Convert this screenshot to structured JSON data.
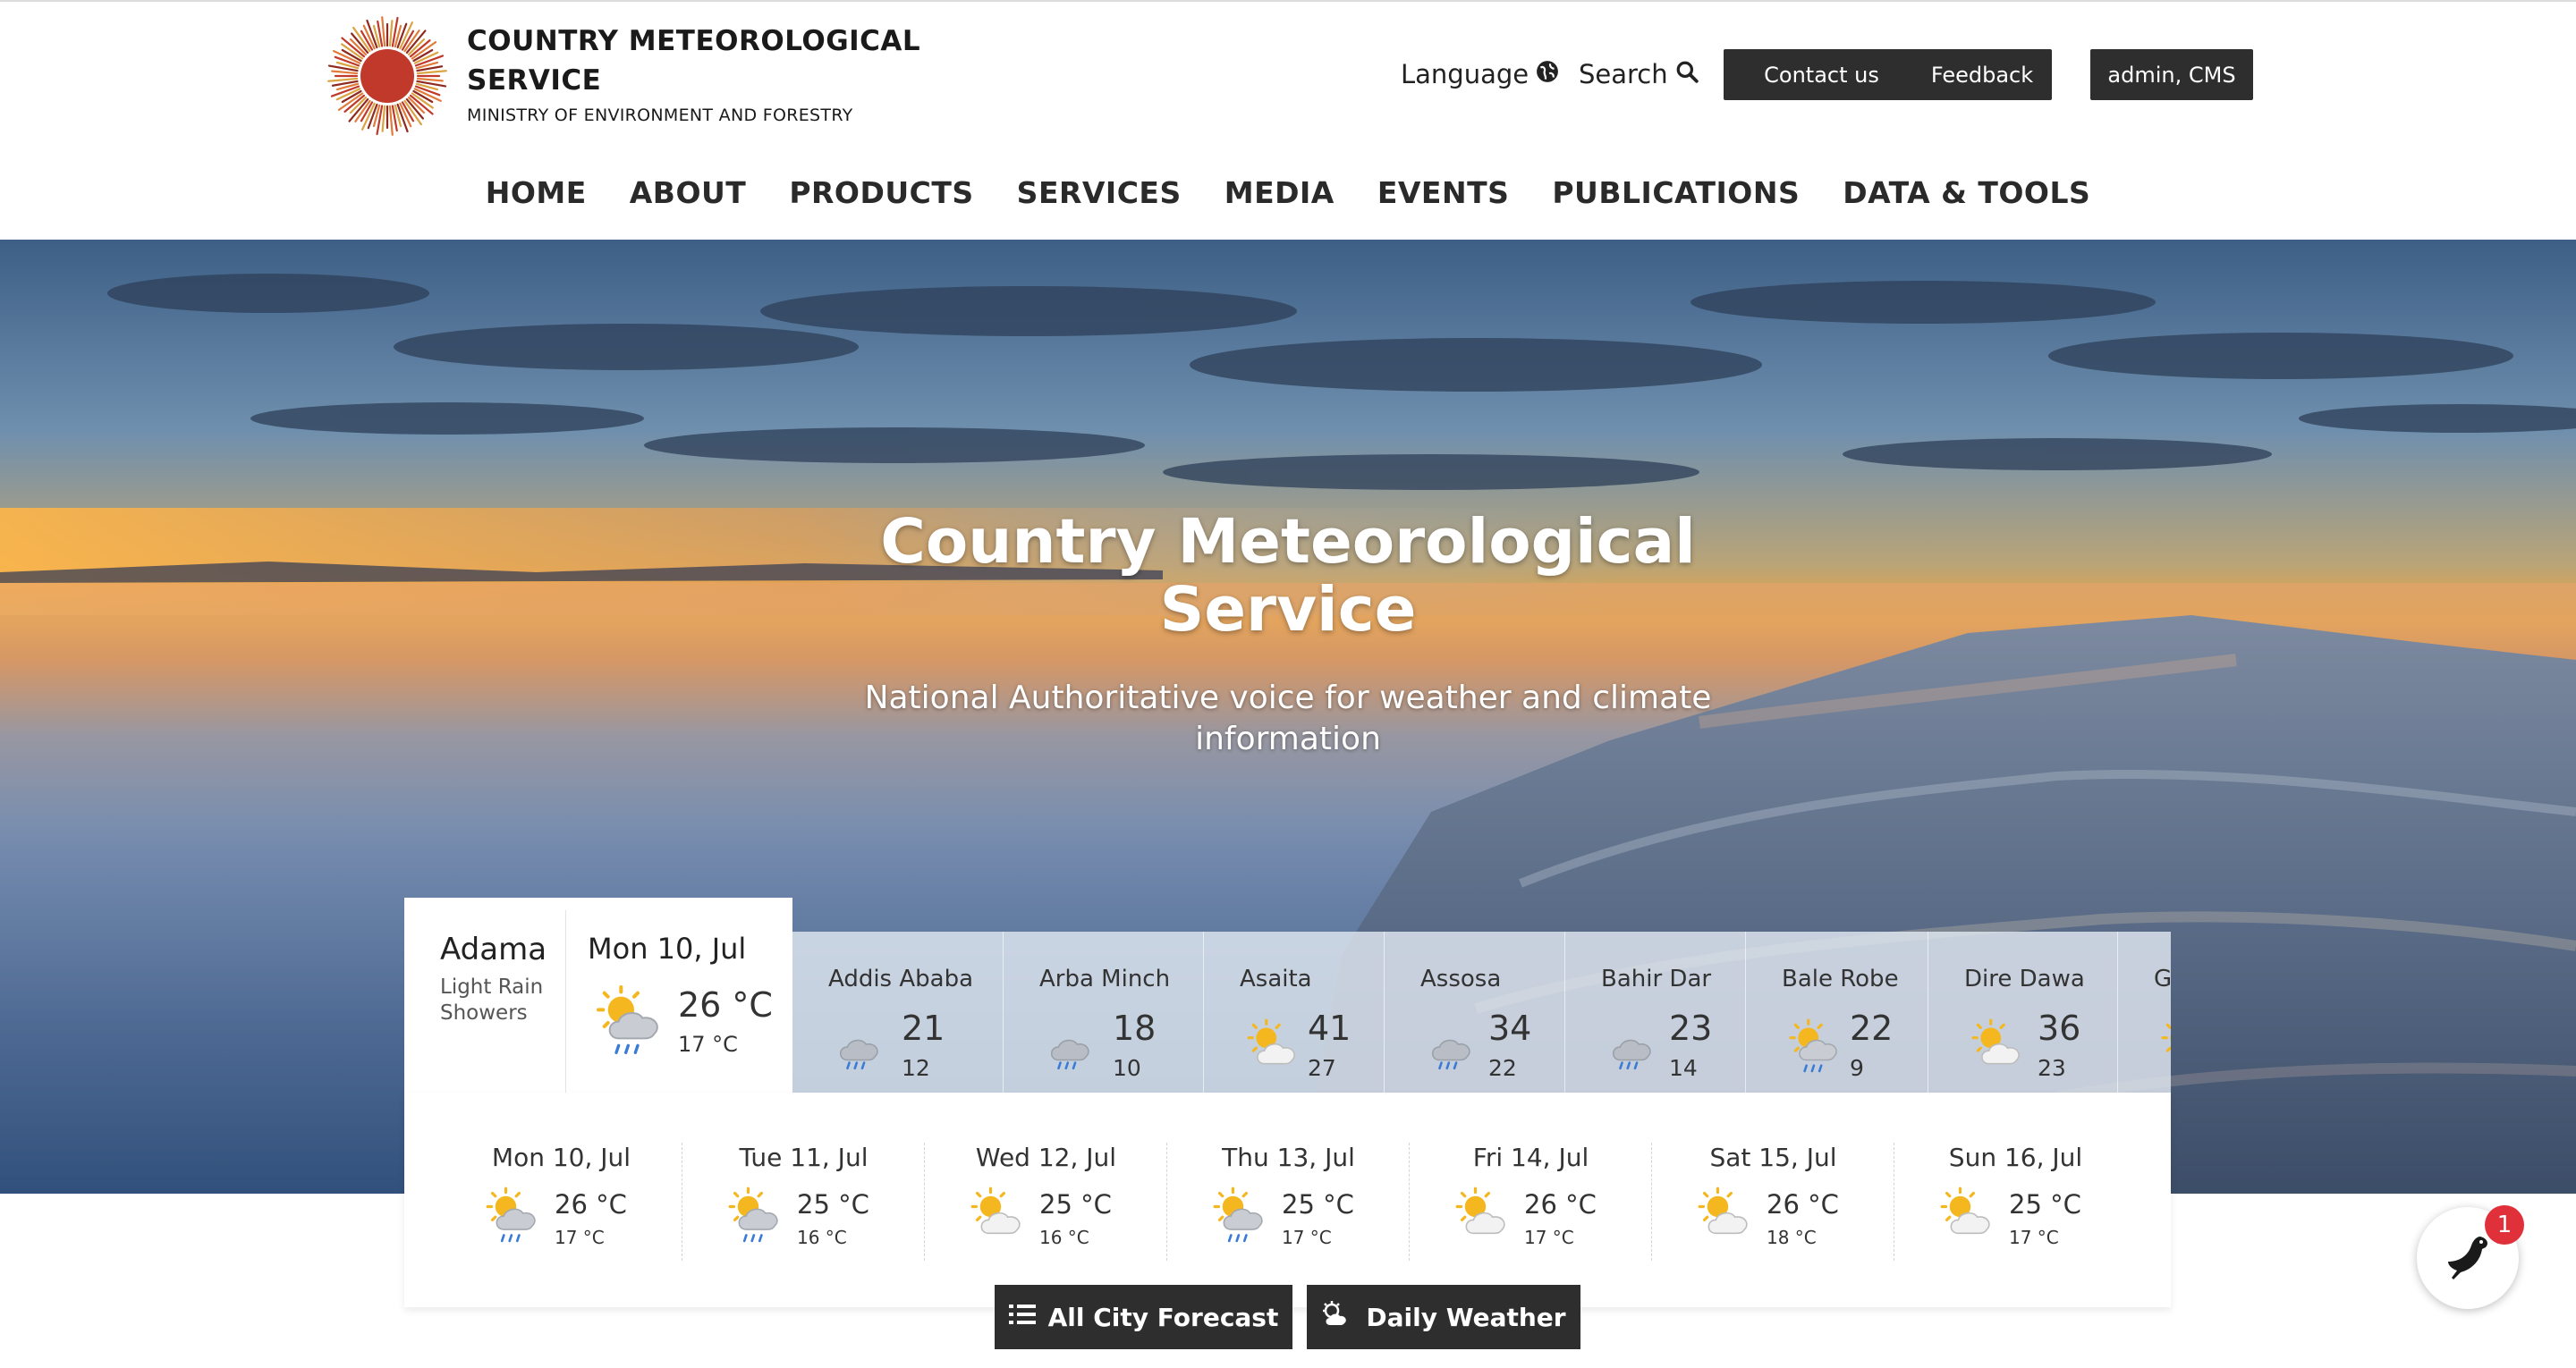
{
  "brand": {
    "title": "COUNTRY METEOROLOGICAL SERVICE",
    "subtitle": "MINISTRY OF ENVIRONMENT AND FORESTRY",
    "logo_icon": "sun-logo-icon"
  },
  "utility": {
    "language_label": "Language",
    "language_icon": "globe-icon",
    "search_label": "Search",
    "search_icon": "search-icon",
    "contact_label": "Contact us",
    "feedback_label": "Feedback",
    "admin_label": "admin, CMS"
  },
  "nav": [
    "HOME",
    "ABOUT",
    "PRODUCTS",
    "SERVICES",
    "MEDIA",
    "EVENTS",
    "PUBLICATIONS",
    "DATA & TOOLS"
  ],
  "hero": {
    "title": "Country Meteorological Service",
    "subtitle": "National Authoritative voice for weather and climate information"
  },
  "current": {
    "city": "Adama",
    "condition": "Light Rain Showers",
    "date": "Mon 10, Jul",
    "max": "26 °C",
    "min": "17 °C",
    "icon": "sun-cloud-rain-icon"
  },
  "cities": [
    {
      "name": "Addis Ababa",
      "max": "21",
      "min": "12",
      "icon": "cloud-rain-icon"
    },
    {
      "name": "Arba Minch",
      "max": "18",
      "min": "10",
      "icon": "cloud-rain-icon"
    },
    {
      "name": "Asaita",
      "max": "41",
      "min": "27",
      "icon": "sun-cloud-icon"
    },
    {
      "name": "Assosa",
      "max": "34",
      "min": "22",
      "icon": "cloud-rain-icon"
    },
    {
      "name": "Bahir Dar",
      "max": "23",
      "min": "14",
      "icon": "cloud-rain-icon"
    },
    {
      "name": "Bale Robe",
      "max": "22",
      "min": "9",
      "icon": "sun-cloud-rain-icon"
    },
    {
      "name": "Dire Dawa",
      "max": "36",
      "min": "23",
      "icon": "sun-cloud-icon"
    },
    {
      "name": "Ga",
      "max": "",
      "min": "",
      "icon": "sun-cloud-icon"
    }
  ],
  "daily": [
    {
      "label": "Mon 10, Jul",
      "max": "26 °C",
      "min": "17 °C",
      "icon": "sun-cloud-rain-icon"
    },
    {
      "label": "Tue 11, Jul",
      "max": "25 °C",
      "min": "16 °C",
      "icon": "sun-cloud-rain-icon"
    },
    {
      "label": "Wed 12, Jul",
      "max": "25 °C",
      "min": "16 °C",
      "icon": "sun-cloud-icon"
    },
    {
      "label": "Thu 13, Jul",
      "max": "25 °C",
      "min": "17 °C",
      "icon": "sun-cloud-rain-icon"
    },
    {
      "label": "Fri 14, Jul",
      "max": "26 °C",
      "min": "17 °C",
      "icon": "sun-cloud-icon"
    },
    {
      "label": "Sat 15, Jul",
      "max": "26 °C",
      "min": "18 °C",
      "icon": "sun-cloud-icon"
    },
    {
      "label": "Sun 16, Jul",
      "max": "25 °C",
      "min": "17 °C",
      "icon": "sun-cloud-icon"
    }
  ],
  "actions": {
    "all_city_label": "All City Forecast",
    "all_city_icon": "list-icon",
    "daily_label": "Daily Weather",
    "daily_icon": "sun-cloud-icon"
  },
  "chat": {
    "icon": "bird-icon",
    "badge": "1"
  },
  "colors": {
    "dark_button": "#2e2e2e",
    "badge": "#e0303a",
    "logo_sun": "#c0392b"
  }
}
